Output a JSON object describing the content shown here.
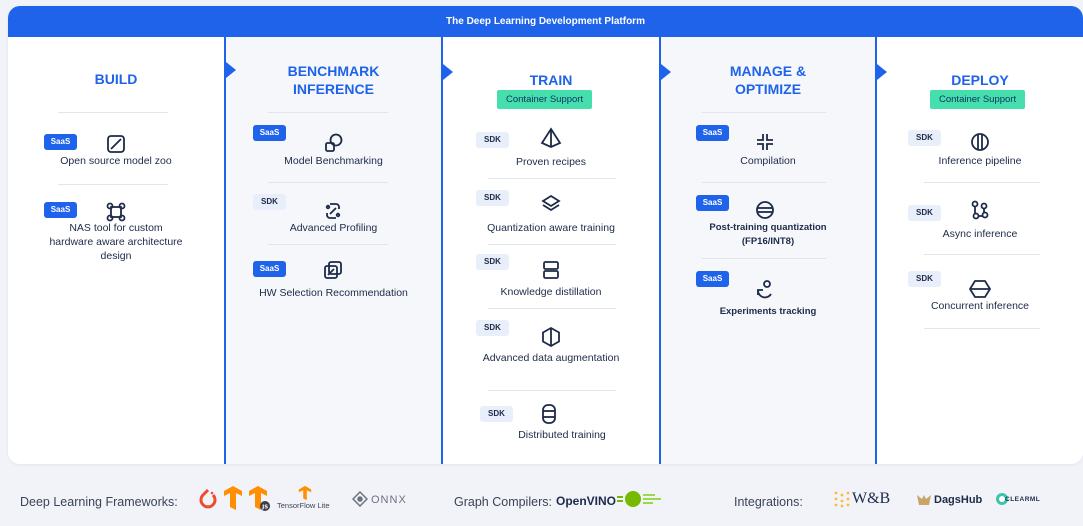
{
  "banner_title": "The Deep Learning Development Platform",
  "colors": {
    "brand_blue": "#1f63ea",
    "container_green": "#45dfae",
    "saas_badge": "#1f63ea",
    "sdk_badge": "#e9eefb"
  },
  "columns": [
    {
      "title": "BUILD",
      "container_support": null,
      "items": [
        {
          "badge": "SaaS",
          "icon": "square-slash-icon",
          "label": "Open source model zoo"
        },
        {
          "badge": "SaaS",
          "icon": "nodes-square-icon",
          "label": "NAS tool for custom hardware aware architecture design"
        }
      ]
    },
    {
      "title": "BENCHMARK\nINFERENCE",
      "container_support": null,
      "items": [
        {
          "badge": "SaaS",
          "icon": "circle-square-icon",
          "label": "Model Benchmarking"
        },
        {
          "badge": "SDK",
          "icon": "link-chain-icon",
          "label": "Advanced Profiling"
        },
        {
          "badge": "SaaS",
          "icon": "layered-square-icon",
          "label": "HW Selection Recommendation"
        }
      ]
    },
    {
      "title": "TRAIN",
      "container_support": "Container Support",
      "items": [
        {
          "badge": "SDK",
          "icon": "prism-icon",
          "label": "Proven recipes"
        },
        {
          "badge": "SDK",
          "icon": "layers-diamond-icon",
          "label": "Quantization aware training"
        },
        {
          "badge": "SDK",
          "icon": "stacked-box-icon",
          "label": "Knowledge distillation"
        },
        {
          "badge": "SDK",
          "icon": "hexagon-split-icon",
          "label": "Advanced data augmentation"
        },
        {
          "badge": "SDK",
          "icon": "database-icon",
          "label": "Distributed training"
        }
      ]
    },
    {
      "title": "MANAGE &\nOPTIMIZE",
      "container_support": null,
      "items": [
        {
          "badge": "SaaS",
          "icon": "compress-arrows-icon",
          "label": "Compilation"
        },
        {
          "badge": "SaaS",
          "icon": "circle-stripes-icon",
          "label": "Post-training quantization\n(FP16/INT8)"
        },
        {
          "badge": "SaaS",
          "icon": "person-refresh-icon",
          "label": "Experiments tracking"
        }
      ]
    },
    {
      "title": "DEPLOY",
      "container_support": "Container Support",
      "items": [
        {
          "badge": "SDK",
          "icon": "circle-lens-icon",
          "label": "Inference pipeline"
        },
        {
          "badge": "SDK",
          "icon": "linked-nodes-icon",
          "label": "Async inference"
        },
        {
          "badge": "SDK",
          "icon": "hexagon-line-icon",
          "label": "Concurrent inference"
        }
      ]
    }
  ],
  "footer": {
    "frameworks_label": "Deep Learning Frameworks:",
    "frameworks_logos": [
      "pytorch-logo",
      "tensorflow-logo",
      "tensorflow-js-logo",
      "tensorflow-lite-logo",
      "onnx-logo"
    ],
    "tensorflow_lite_text": "TensorFlow Lite",
    "onnx_text": "ONNX",
    "compilers_label": "Graph Compilers:",
    "openvino_text": "OpenVINO",
    "compilers_logos": [
      "openvino-logo",
      "tensorrt-logo"
    ],
    "integrations_label": "Integrations:",
    "wandb_text": "W&B",
    "dagshub_text": "DagsHub",
    "clearml_text": "CLEARML",
    "integrations_logos": [
      "wandb-logo",
      "dagshub-logo",
      "clearml-logo"
    ]
  }
}
